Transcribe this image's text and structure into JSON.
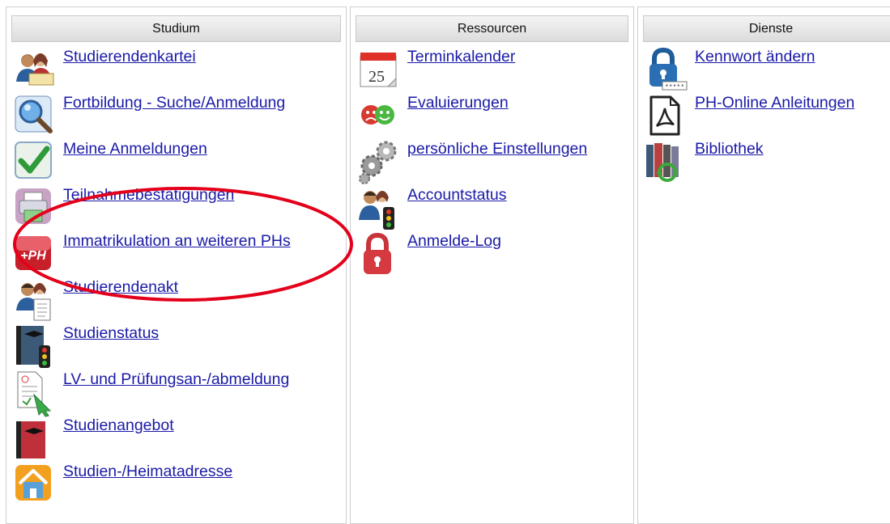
{
  "columns": {
    "studium": {
      "header": "Studium",
      "items": [
        {
          "label": "Studierendenkartei",
          "icon": "students-icon"
        },
        {
          "label": "Fortbildung - Suche/Anmeldung",
          "icon": "magnifier-icon"
        },
        {
          "label": "Meine Anmeldungen",
          "icon": "checkmark-icon"
        },
        {
          "label": "Teilnahmebestätigungen",
          "icon": "printer-icon"
        },
        {
          "label": "Immatrikulation an weiteren PHs",
          "icon": "plus-ph-icon"
        },
        {
          "label": "Studierendenakt",
          "icon": "student-file-icon"
        },
        {
          "label": "Studienstatus",
          "icon": "book-traffic-light-icon"
        },
        {
          "label": "LV- und Prüfungsan-/abmeldung",
          "icon": "exam-registration-icon"
        },
        {
          "label": "Studienangebot",
          "icon": "red-book-icon"
        },
        {
          "label": "Studien-/Heimatadresse",
          "icon": "home-icon"
        }
      ]
    },
    "ressourcen": {
      "header": "Ressourcen",
      "items": [
        {
          "label": "Terminkalender",
          "icon": "calendar-icon",
          "day": "25"
        },
        {
          "label": "Evaluierungen",
          "icon": "smileys-icon"
        },
        {
          "label": "persönliche Einstellungen",
          "icon": "gears-icon"
        },
        {
          "label": "Accountstatus",
          "icon": "account-status-icon"
        },
        {
          "label": "Anmelde-Log",
          "icon": "padlock-icon"
        }
      ]
    },
    "dienste": {
      "header": "Dienste",
      "items": [
        {
          "label": "Kennwort ändern",
          "icon": "password-lock-icon",
          "mask": "*****"
        },
        {
          "label": "PH-Online Anleitungen",
          "icon": "pdf-icon"
        },
        {
          "label": "Bibliothek",
          "icon": "library-icon"
        }
      ]
    }
  },
  "colors": {
    "link": "#1a1aa8",
    "annotation": "#e4001b"
  }
}
